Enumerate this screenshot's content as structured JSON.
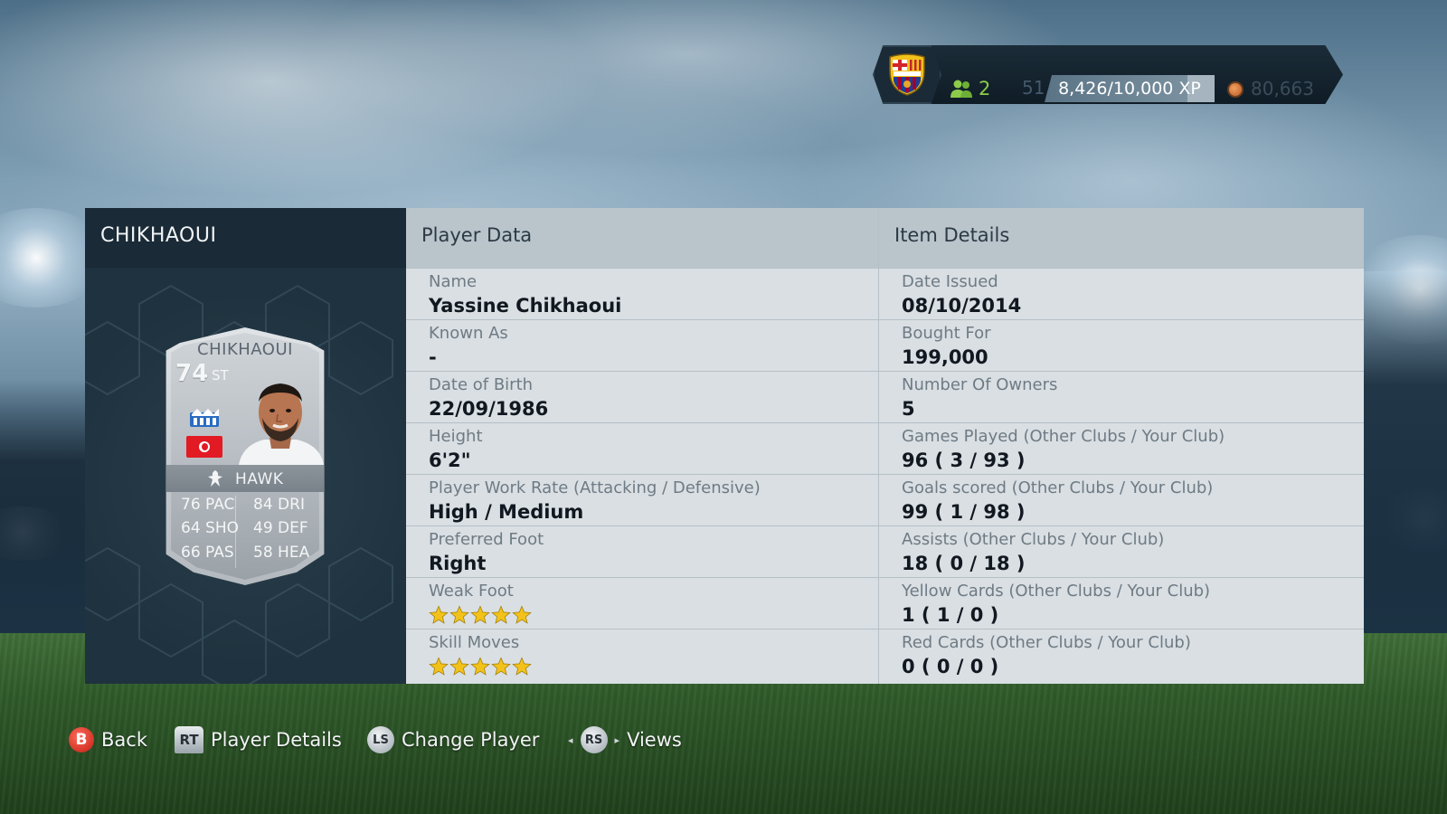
{
  "status_bar": {
    "club": "FC Barcelona crest",
    "managers_count": "2",
    "level": "51",
    "xp": "8,426/10,000 XP",
    "xp_progress": 0.8426,
    "coins": "80,663",
    "coin_icon": "coin-icon",
    "manager_icon": "managers-icon"
  },
  "player_panel": {
    "title": "CHIKHAOUI",
    "card": {
      "name": "CHIKHAOUI",
      "rating": "74",
      "position": "ST",
      "chemistry_style": "HAWK",
      "stats": [
        {
          "value": "76",
          "label": "PAC"
        },
        {
          "value": "84",
          "label": "DRI"
        },
        {
          "value": "64",
          "label": "SHO"
        },
        {
          "value": "49",
          "label": "DEF"
        },
        {
          "value": "66",
          "label": "PAS"
        },
        {
          "value": "58",
          "label": "HEA"
        }
      ],
      "nation": "Tunisia",
      "club": "FC Zürich"
    }
  },
  "player_data": {
    "title": "Player Data",
    "rows": [
      {
        "label": "Name",
        "value": "Yassine Chikhaoui"
      },
      {
        "label": "Known As",
        "value": "-"
      },
      {
        "label": "Date of Birth",
        "value": "22/09/1986"
      },
      {
        "label": "Height",
        "value": "6'2\""
      },
      {
        "label": "Player Work Rate (Attacking / Defensive)",
        "value": "High / Medium"
      },
      {
        "label": "Preferred Foot",
        "value": "Right"
      },
      {
        "label": "Weak Foot",
        "stars": 5
      },
      {
        "label": "Skill Moves",
        "stars": 5
      }
    ]
  },
  "item_details": {
    "title": "Item Details",
    "rows": [
      {
        "label": "Date Issued",
        "value": "08/10/2014"
      },
      {
        "label": "Bought For",
        "value": "199,000"
      },
      {
        "label": "Number Of Owners",
        "value": "5"
      },
      {
        "label": "Games Played (Other Clubs / Your Club)",
        "value": "96 ( 3 / 93 )"
      },
      {
        "label": "Goals scored (Other Clubs / Your Club)",
        "value": "99 ( 1 / 98 )"
      },
      {
        "label": "Assists (Other Clubs / Your Club)",
        "value": "18 ( 0 / 18 )"
      },
      {
        "label": "Yellow Cards (Other Clubs / Your Club)",
        "value": "1 ( 1 / 0 )"
      },
      {
        "label": "Red Cards (Other Clubs / Your Club)",
        "value": "0 ( 0 / 0 )"
      }
    ]
  },
  "controls": [
    {
      "button": "B",
      "label": "Back"
    },
    {
      "button": "RT",
      "label": "Player Details"
    },
    {
      "button": "LS",
      "label": "Change Player"
    },
    {
      "button": "RS",
      "label": "Views"
    }
  ],
  "colors": {
    "header_dark": "#1a2a36",
    "table_bg": "#d9dfe3",
    "header_light": "#b9c4cb",
    "star_gold": "#f2c21a",
    "level_green": "#8ccb4a"
  }
}
